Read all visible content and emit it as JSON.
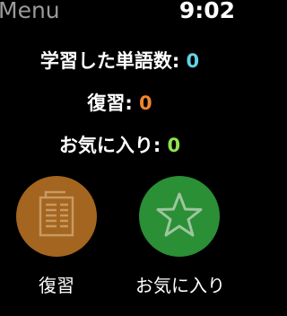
{
  "status_bar": {
    "back_title": "Menu",
    "time": "9:02"
  },
  "stats": {
    "learned_label": "学習した単語数:",
    "learned_value": "0",
    "review_label": "復習:",
    "review_value": "0",
    "favorites_label": "お気に入り:",
    "favorites_value": "0"
  },
  "actions": {
    "review": {
      "label": "復習",
      "icon": "document-icon",
      "color": "#a3651f"
    },
    "favorites": {
      "label": "お気に入り",
      "icon": "star-icon",
      "color": "#2a8f35"
    }
  },
  "colors": {
    "learned_value": "#63d3e6",
    "review_value": "#f0862d",
    "favorites_value": "#90e24d"
  }
}
